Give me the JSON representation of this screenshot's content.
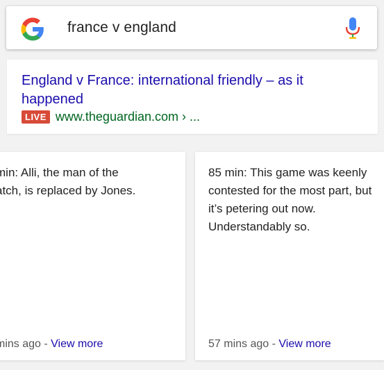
{
  "search": {
    "query": "france v england"
  },
  "result": {
    "title": "England v France: international friendly – as it happened",
    "live_badge": "LIVE",
    "url": "www.theguardian.com › ..."
  },
  "cards": [
    {
      "text": "min: Alli, the man of the atch, is replaced by Jones.",
      "text_line1": "min: Alli, the man of the",
      "text_line2": "atch, is replaced by Jones.",
      "time": "mins ago",
      "separator": " - ",
      "link": "View more"
    },
    {
      "text": "85 min: This game was keenly contested for the most part, but it’s petering out now. Understandably so.",
      "time": "57 mins ago",
      "separator": " - ",
      "link": "View more"
    }
  ],
  "colors": {
    "link": "#1a0dab",
    "url": "#006621",
    "live": "#d84a38"
  }
}
